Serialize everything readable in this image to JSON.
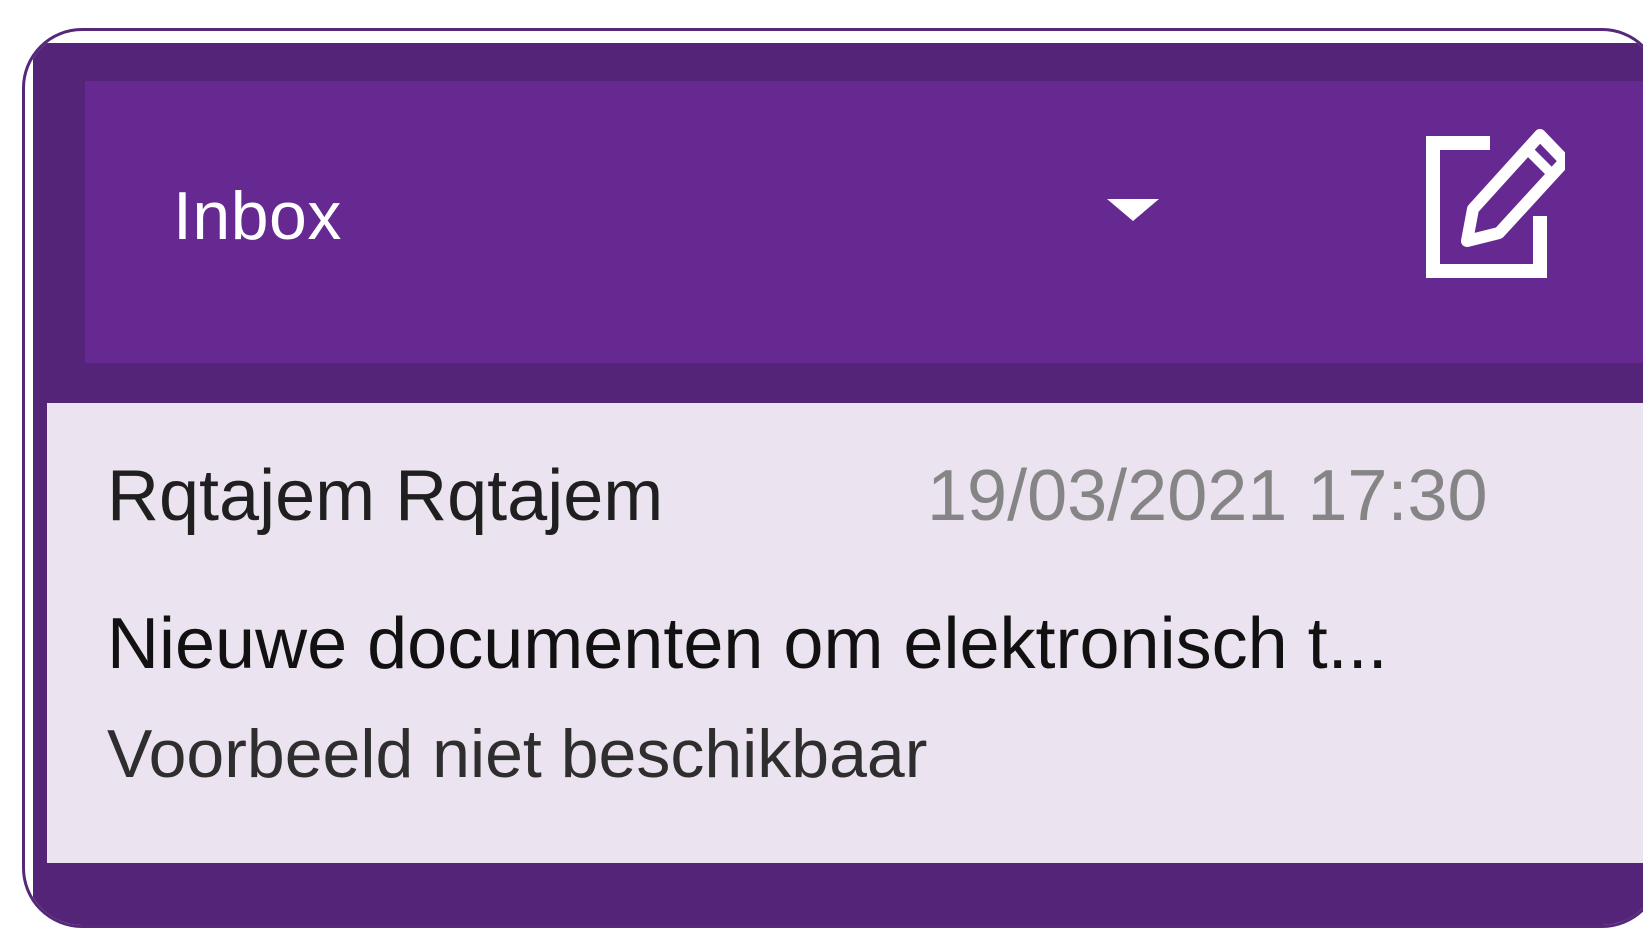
{
  "header": {
    "folder_title": "Inbox",
    "dropdown_icon": "caret-down-icon",
    "compose_icon": "compose-icon"
  },
  "message": {
    "sender": "Rqtajem Rqtajem",
    "date": "19/03/2021 17:30",
    "subject": "Nieuwe documenten om elektronisch t...",
    "preview": "Voorbeeld niet beschikbaar"
  },
  "colors": {
    "header_bg": "#662891",
    "frame_bg": "#532477",
    "list_item_bg": "#ebe3ef",
    "date_text": "#858585"
  }
}
